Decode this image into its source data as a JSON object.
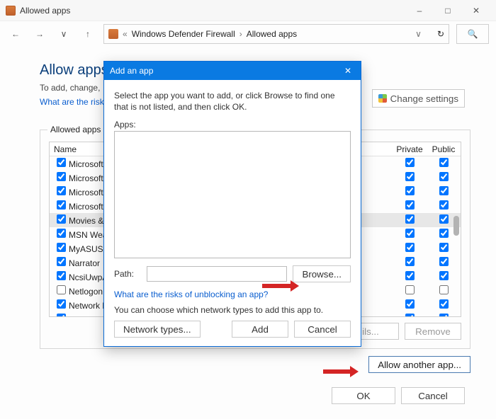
{
  "window": {
    "title": "Allowed apps"
  },
  "nav": {
    "breadcrumb_root": "Windows Defender Firewall",
    "breadcrumb_leaf": "Allowed apps"
  },
  "page": {
    "heading": "Allow apps to",
    "subline": "To add, change,",
    "risks_link": "What are the risk",
    "change_settings": "Change settings"
  },
  "group": {
    "label": "Allowed apps a",
    "col_name": "Name",
    "col_private": "Private",
    "col_public": "Public",
    "rows": [
      {
        "label": "Microsoft S",
        "c": true,
        "p": true,
        "q": true,
        "sel": false
      },
      {
        "label": "Microsoft S",
        "c": true,
        "p": true,
        "q": true,
        "sel": false
      },
      {
        "label": "Microsoft T",
        "c": true,
        "p": true,
        "q": true,
        "sel": false
      },
      {
        "label": "Microsoft T",
        "c": true,
        "p": true,
        "q": true,
        "sel": false
      },
      {
        "label": "Movies & T",
        "c": true,
        "p": true,
        "q": true,
        "sel": true
      },
      {
        "label": "MSN Weath",
        "c": true,
        "p": true,
        "q": true,
        "sel": false
      },
      {
        "label": "MyASUS",
        "c": true,
        "p": true,
        "q": true,
        "sel": false
      },
      {
        "label": "Narrator",
        "c": true,
        "p": true,
        "q": true,
        "sel": false
      },
      {
        "label": "NcsiUwpAp",
        "c": true,
        "p": true,
        "q": true,
        "sel": false
      },
      {
        "label": "Netlogon S",
        "c": false,
        "p": false,
        "q": false,
        "sel": false
      },
      {
        "label": "Network Di",
        "c": true,
        "p": true,
        "q": true,
        "sel": false
      },
      {
        "label": "News",
        "c": true,
        "p": true,
        "q": true,
        "sel": false
      }
    ],
    "details": "ils...",
    "remove": "Remove",
    "allow_another": "Allow another app..."
  },
  "footer": {
    "ok": "OK",
    "cancel": "Cancel"
  },
  "modal": {
    "title": "Add an app",
    "instr": "Select the app you want to add, or click Browse to find one that is not listed, and then click OK.",
    "apps_label": "Apps:",
    "path_label": "Path:",
    "path_value": "",
    "browse": "Browse...",
    "risks": "What are the risks of unblocking an app?",
    "choose_net": "You can choose which network types to add this app to.",
    "net_types": "Network types...",
    "add": "Add",
    "cancel": "Cancel"
  }
}
